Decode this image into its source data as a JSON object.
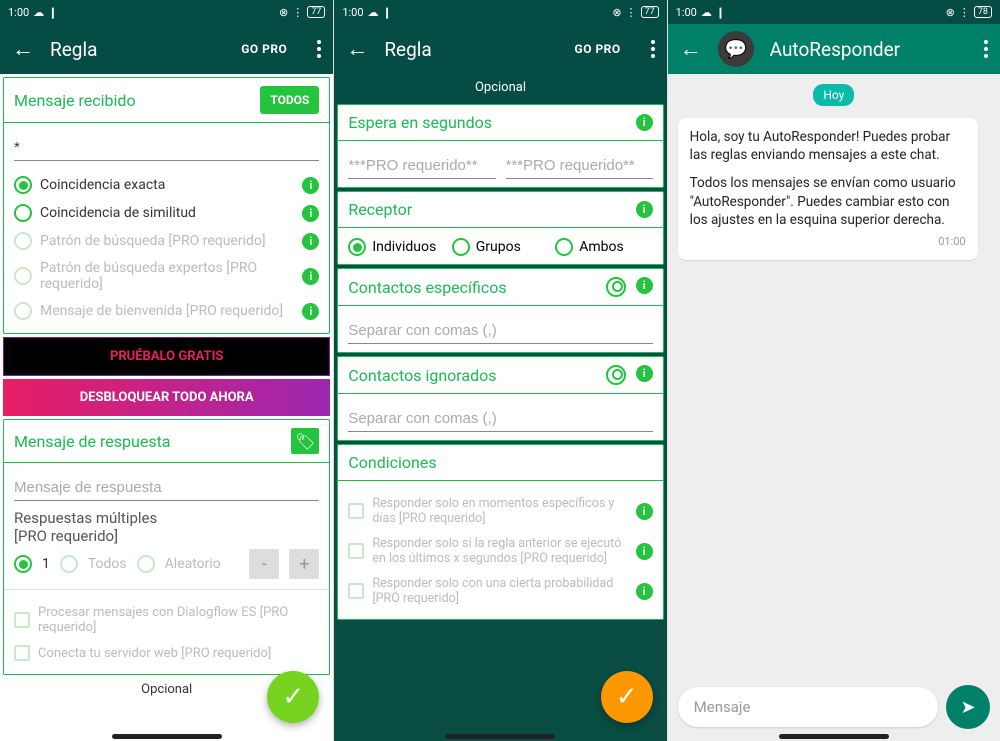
{
  "status": {
    "time": "1:00",
    "battery1": "77",
    "battery2": "77",
    "battery3": "78"
  },
  "phone1": {
    "title": "Regla",
    "go_pro": "GO PRO",
    "received": {
      "title": "Mensaje recibido",
      "todos": "TODOS",
      "input_value": "*",
      "options": [
        {
          "label": "Coincidencia exacta",
          "checked": true,
          "disabled": false
        },
        {
          "label": "Coincidencia de similitud",
          "checked": false,
          "disabled": false
        },
        {
          "label": "Patrón de búsqueda [PRO requerido]",
          "checked": false,
          "disabled": true
        },
        {
          "label": "Patrón de búsqueda expertos [PRO requerido]",
          "checked": false,
          "disabled": true
        },
        {
          "label": "Mensaje de bienvenida [PRO requerido]",
          "checked": false,
          "disabled": true
        }
      ]
    },
    "pruebalo": "PRUÉBALO GRATIS",
    "unlock": "DESBLOQUEAR TODO AHORA",
    "response": {
      "title": "Mensaje de respuesta",
      "placeholder": "Mensaje de respuesta",
      "multi_title": "Respuestas múltiples\n[PRO requerido]",
      "one": "1",
      "todos": "Todos",
      "aleatorio": "Aleatorio",
      "dialogflow": "Procesar mensajes con Dialogflow ES [PRO requerido]",
      "webhook": "Conecta tu servidor web [PRO requerido]"
    },
    "opcional": "Opcional"
  },
  "phone2": {
    "title": "Regla",
    "go_pro": "GO PRO",
    "opcional": "Opcional",
    "wait": {
      "title": "Espera en segundos",
      "ph": "***PRO requerido**"
    },
    "receptor": {
      "title": "Receptor",
      "ind": "Individuos",
      "grp": "Grupos",
      "amb": "Ambos"
    },
    "specific": {
      "title": "Contactos específicos",
      "ph": "Separar con comas (,)"
    },
    "ignored": {
      "title": "Contactos ignorados",
      "ph": "Separar con comas (,)"
    },
    "cond": {
      "title": "Condiciones",
      "c1": "Responder solo en momentos específicos y días [PRO requerido]",
      "c2": "Responder solo si la regla anterior se ejecutó en los últimos x segundos [PRO requerido]",
      "c3": "Responder solo con una cierta probabilidad [PRO requerido]"
    }
  },
  "phone3": {
    "title": "AutoResponder",
    "day": "Hoy",
    "msg1": "Hola, soy tu AutoResponder! Puedes probar las reglas enviando mensajes a este chat.",
    "msg2": "Todos los mensajes se envían como usuario \"AutoResponder\". Puedes cambiar esto con los ajustes en la esquina superior derecha.",
    "time": "01:00",
    "input_ph": "Mensaje"
  }
}
